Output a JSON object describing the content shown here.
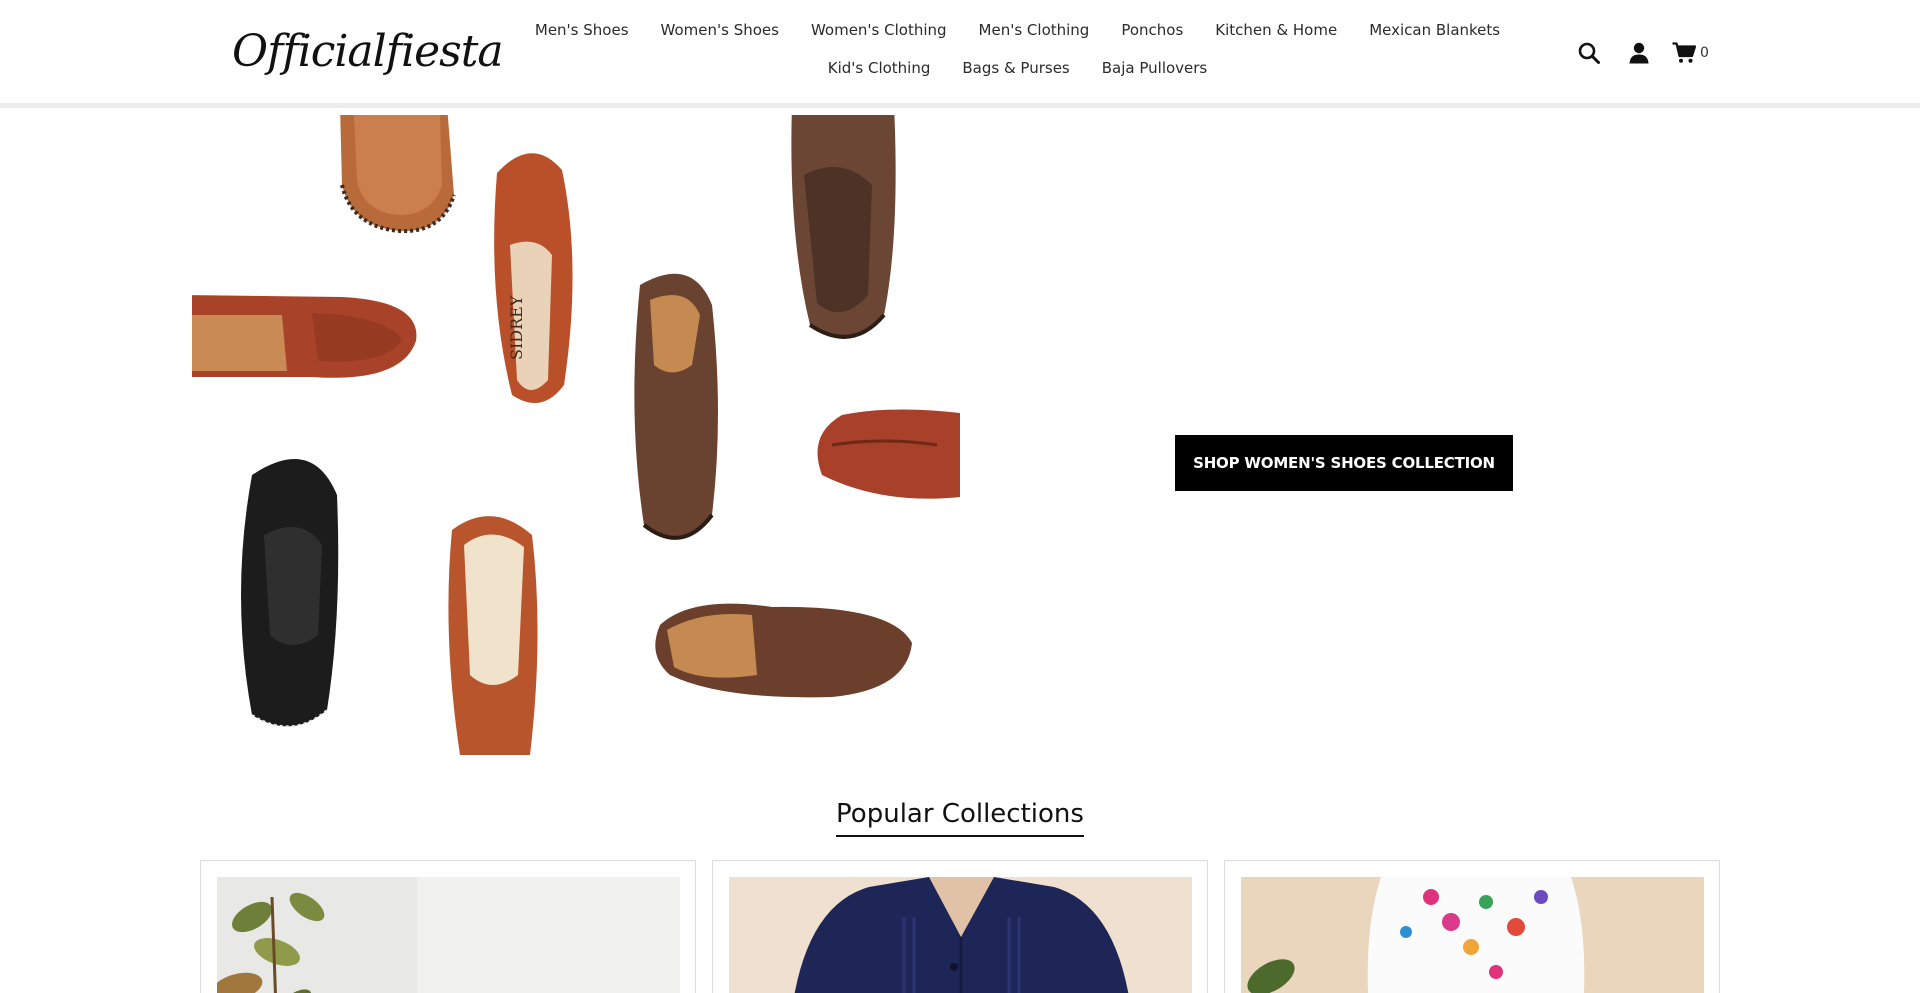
{
  "header": {
    "logo_text": "Officialfiesta",
    "nav": [
      {
        "label": "Men's Shoes"
      },
      {
        "label": "Women's Shoes"
      },
      {
        "label": "Women's Clothing"
      },
      {
        "label": "Men's Clothing"
      },
      {
        "label": "Ponchos"
      },
      {
        "label": "Kitchen & Home"
      },
      {
        "label": "Mexican Blankets"
      },
      {
        "label": "Kid's Clothing"
      },
      {
        "label": "Bags & Purses"
      },
      {
        "label": "Baja Pullovers"
      }
    ],
    "icons": {
      "search": "search-icon",
      "account": "user-icon",
      "cart": "cart-icon"
    },
    "cart_count": "0"
  },
  "hero": {
    "image": "womens-huarache-sandals-collage",
    "cta_label": "SHOP WOMEN'S SHOES COLLECTION"
  },
  "collections": {
    "title": "Popular Collections",
    "cards": [
      {
        "image": "plant-lifestyle-photo"
      },
      {
        "image": "navy-guayabera-shirt-photo"
      },
      {
        "image": "white-embroidered-dress-photo"
      }
    ]
  },
  "colors": {
    "cta_background": "#000000",
    "cta_text": "#ffffff",
    "header_border": "#ececec",
    "card_border": "#dcdcdc"
  }
}
